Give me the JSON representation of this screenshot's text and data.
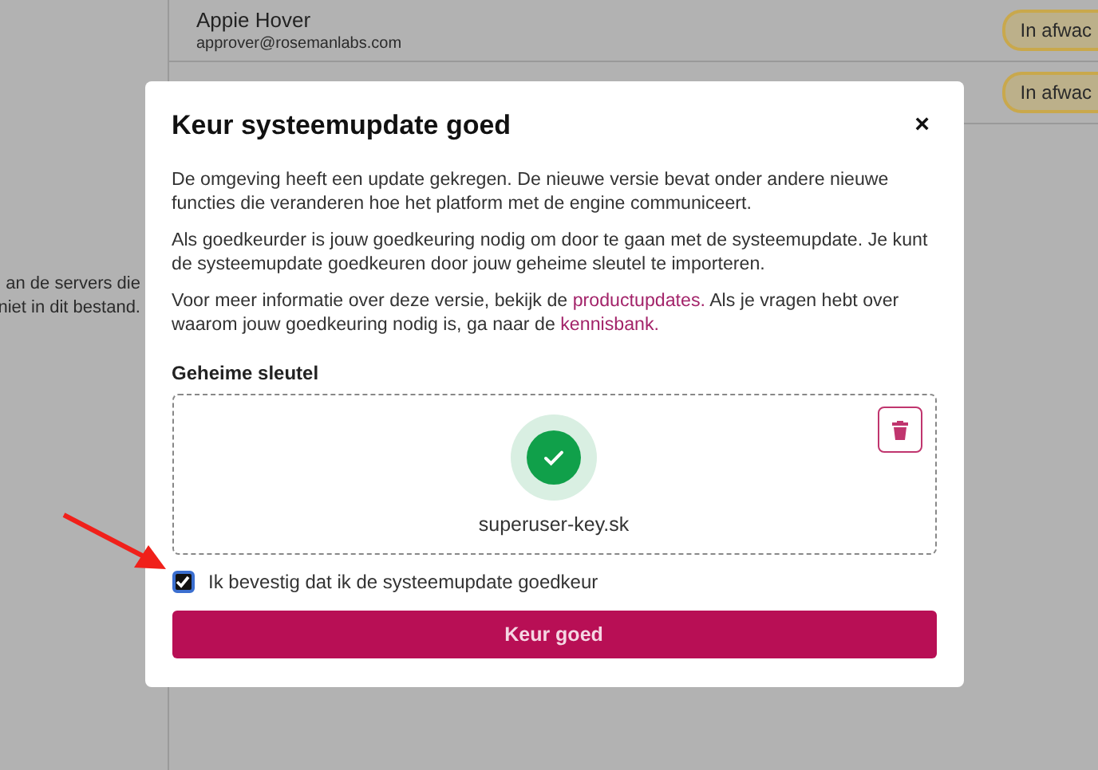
{
  "background": {
    "side_text": [
      "an de servers die",
      "niet in dit bestand."
    ],
    "rows": [
      {
        "name": "Appie Hover",
        "email": "approver@rosemanlabs.com",
        "status": "In afwac"
      },
      {
        "status": "In afwac"
      }
    ]
  },
  "dialog": {
    "title": "Keur systeemupdate goed",
    "close": "×",
    "paragraphs": [
      "De omgeving heeft een update gekregen. De nieuwe versie bevat onder andere nieuwe functies die veranderen hoe het platform met de engine communiceert.",
      "Als goedkeurder is jouw goedkeuring nodig om door te gaan met de systeemupdate. Je kunt de systeemupdate goedkeuren door jouw geheime sleutel te importeren."
    ],
    "info": {
      "before": "Voor meer informatie over deze versie, bekijk de ",
      "link1": "productupdates.",
      "middle": " Als je vragen hebt over waarom jouw goedkeuring nodig is, ga naar de ",
      "link2": "kennisbank."
    },
    "key_label": "Geheime sleutel",
    "file_name": "superuser-key.sk",
    "confirm": {
      "label": "Ik bevestig dat ik de systeemupdate goedkeur",
      "checked": true
    },
    "submit": "Keur goed"
  }
}
